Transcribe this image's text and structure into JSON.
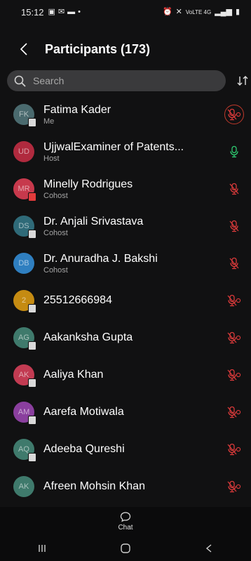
{
  "status_bar": {
    "time": "15:12",
    "network_label": "VoLTE 4G"
  },
  "header": {
    "back_icon": "chevron-left-icon",
    "title": "Participants (173)"
  },
  "search": {
    "placeholder": "Search",
    "icon": "search-icon",
    "sort_icon": "sort-icon"
  },
  "colors": {
    "mic_muted": "#d93a3a",
    "mic_active": "#2ecc71",
    "background": "#111112"
  },
  "participants": [
    {
      "initials": "FK",
      "name": "Fatima Kader",
      "role": "Me",
      "avatar_color": "#4a6a6e",
      "badge": "white",
      "mic": "muted-request"
    },
    {
      "initials": "UD",
      "name": "UjjwalExaminer of Patents...",
      "role": "Host",
      "avatar_color": "#b02a3e",
      "badge": "",
      "mic": "active"
    },
    {
      "initials": "MR",
      "name": "Minelly Rodrigues",
      "role": "Cohost",
      "avatar_color": "#c7394c",
      "badge": "red",
      "mic": "muted"
    },
    {
      "initials": "DS",
      "name": "Dr. Anjali Srivastava",
      "role": "Cohost",
      "avatar_color": "#2f6a78",
      "badge": "white",
      "mic": "muted"
    },
    {
      "initials": "DB",
      "name": "Dr. Anuradha J. Bakshi",
      "role": "Cohost",
      "avatar_color": "#2f7fc0",
      "badge": "",
      "mic": "muted"
    },
    {
      "initials": "2",
      "name": "25512666984",
      "role": "",
      "avatar_color": "#c58b12",
      "badge": "white",
      "mic": "muted-request"
    },
    {
      "initials": "AG",
      "name": "Aakanksha Gupta",
      "role": "",
      "avatar_color": "#3f7a6c",
      "badge": "white",
      "mic": "muted-request"
    },
    {
      "initials": "AK",
      "name": "Aaliya Khan",
      "role": "",
      "avatar_color": "#c23b52",
      "badge": "white",
      "mic": "muted-request"
    },
    {
      "initials": "AM",
      "name": "Aarefa Motiwala",
      "role": "",
      "avatar_color": "#8a3f9e",
      "badge": "white",
      "mic": "muted-request"
    },
    {
      "initials": "AQ",
      "name": "Adeeba Qureshi",
      "role": "",
      "avatar_color": "#3f7a6c",
      "badge": "white",
      "mic": "muted-request"
    },
    {
      "initials": "AK",
      "name": "Afreen Mohsin Khan",
      "role": "",
      "avatar_color": "#3f7a6c",
      "badge": "",
      "mic": "muted-request"
    }
  ],
  "bottom_tab": {
    "icon": "chat-bubble-icon",
    "label": "Chat"
  },
  "nav": {
    "recents_icon": "recents-icon",
    "home_icon": "home-icon",
    "back_icon": "back-arrow-icon"
  }
}
